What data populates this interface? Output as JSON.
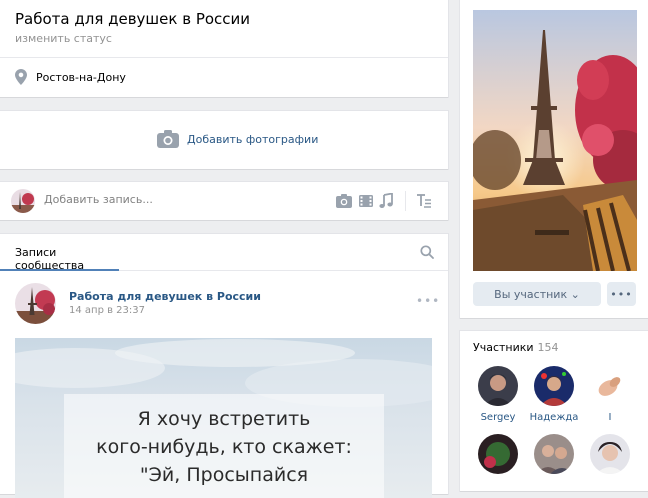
{
  "header": {
    "title": "Работа для девушек в России",
    "status_link": "изменить статус",
    "location": "Ростов-на-Дону"
  },
  "photos": {
    "add_label": "Добавить фотографии"
  },
  "composer": {
    "placeholder": "Добавить запись...",
    "tools": [
      "camera-icon",
      "video-icon",
      "music-icon",
      "text-format-icon"
    ]
  },
  "wall": {
    "tab_label": "Записи сообщества",
    "post": {
      "author": "Работа для девушек в России",
      "date": "14 апр в 23:37",
      "menu": "•••",
      "quote_lines": [
        "Я хочу встретить",
        "кого-нибудь, кто скажет:",
        "\"Эй, Просыпайся"
      ]
    }
  },
  "sidebar": {
    "member_button": "Вы участник ⌄",
    "more_button": "•••",
    "members_title": "Участники",
    "members_count": "154",
    "members": [
      {
        "name": "Sergey"
      },
      {
        "name": "Надежда"
      },
      {
        "name": "I"
      },
      {
        "name": ""
      },
      {
        "name": ""
      },
      {
        "name": ""
      }
    ]
  },
  "colors": {
    "link": "#2a5885",
    "accent": "#5181b8",
    "background": "#edeef0",
    "icon": "#99a2ad"
  }
}
